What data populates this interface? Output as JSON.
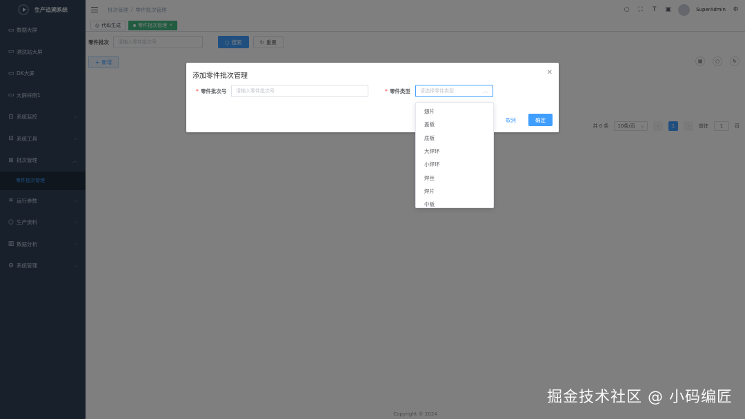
{
  "app": {
    "title": "生产追溯系统"
  },
  "sidebar": {
    "items": [
      {
        "label": "数据大屏",
        "icon": "monitor-icon",
        "has_arrow": false
      },
      {
        "label": "溯洗站大屏",
        "icon": "monitor-icon",
        "has_arrow": false
      },
      {
        "label": "DK大屏",
        "icon": "monitor-icon",
        "has_arrow": false
      },
      {
        "label": "大屏样例1",
        "icon": "monitor-icon",
        "has_arrow": false
      },
      {
        "label": "系统监控",
        "icon": "monitor-chart-icon",
        "has_arrow": true
      },
      {
        "label": "系统工具",
        "icon": "toolbox-icon",
        "has_arrow": true
      },
      {
        "label": "批次管理",
        "icon": "batch-icon",
        "has_arrow": true,
        "expanded": true
      }
    ],
    "sub_item": {
      "label": "零件批次管理"
    },
    "items_after": [
      {
        "label": "运行参数",
        "icon": "layers-icon"
      },
      {
        "label": "生产资料",
        "icon": "cube-icon"
      },
      {
        "label": "数据分析",
        "icon": "bar-chart-icon"
      },
      {
        "label": "系统管理",
        "icon": "gear-icon"
      }
    ]
  },
  "header": {
    "breadcrumb": [
      "批次管理",
      "/",
      "零件批次管理"
    ],
    "username": "SuperAdmin"
  },
  "tags": {
    "items": [
      {
        "label": "代码生成"
      },
      {
        "label": "零件批次管理",
        "active": true
      }
    ]
  },
  "search": {
    "label": "零件批次",
    "placeholder": "请输入零件批次号",
    "search_btn": "搜索",
    "reset_btn": "重置",
    "add_btn": "新增"
  },
  "pager": {
    "total": "共 0 条",
    "page_size": "10条/页",
    "current": "1",
    "goto_label": "前往",
    "goto_value": "1",
    "page_suffix": "页"
  },
  "footer": {
    "text": "Copyright © 2024"
  },
  "dialog": {
    "title": "添加零件批次管理",
    "field1_label": "零件批次号",
    "field1_placeholder": "请输入零件批次号",
    "field2_label": "零件类型",
    "field2_placeholder": "请选择零件类型",
    "cancel": "取消",
    "confirm": "确定"
  },
  "dropdown": {
    "options": [
      "翅片",
      "盖板",
      "底板",
      "大焊环",
      "小焊环",
      "焊丝",
      "焊片",
      "中板"
    ]
  },
  "watermark": {
    "text": "掘金技术社区 @ 小码编匠"
  },
  "colors": {
    "sidebar_bg": "#304156",
    "primary": "#409eff",
    "tag_active": "#42b983"
  }
}
